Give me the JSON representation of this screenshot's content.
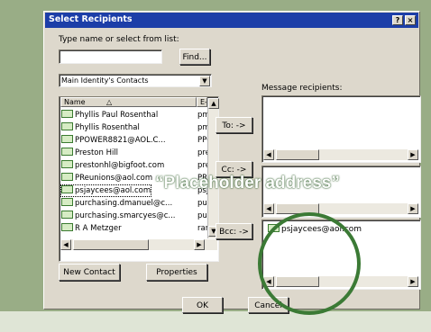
{
  "dialog": {
    "title": "Select Recipients",
    "help_glyph": "?",
    "close_glyph": "×"
  },
  "search": {
    "label": "Type name or select from list:",
    "value": "",
    "find_button": "Find..."
  },
  "address_book": {
    "selected": "Main Identity's Contacts",
    "dropdown_glyph": "▼"
  },
  "contact_list": {
    "columns": [
      "Name",
      "E-Mail"
    ],
    "rows": [
      {
        "name": "Phyllis Paul Rosenthal",
        "email": "pmr"
      },
      {
        "name": "Phyllis Rosenthal",
        "email": "pmr"
      },
      {
        "name": "PPOWER8821@AOL.C...",
        "email": "PPO"
      },
      {
        "name": "Preston Hill",
        "email": "prest"
      },
      {
        "name": "prestonhl@bigfoot.com",
        "email": "prest"
      },
      {
        "name": "PReunions@aol.com",
        "email": "PRe"
      },
      {
        "name": "psjaycees@aol.com",
        "email": "psja"
      },
      {
        "name": "purchasing.dmanuel@c...",
        "email": "purc"
      },
      {
        "name": "purchasing.smarcyes@c...",
        "email": "purc"
      },
      {
        "name": "R A Metzger",
        "email": "ramo"
      }
    ],
    "highlighted_index": 6
  },
  "recipients": {
    "label": "Message recipients:",
    "to_button": "To: ->",
    "cc_button": "Cc: ->",
    "bcc_button": "Bcc: ->",
    "bcc_entry": "psjaycees@aol.com"
  },
  "bottom_buttons": {
    "new_contact": "New Contact",
    "properties": "Properties",
    "ok": "OK",
    "cancel": "Cancel"
  },
  "annotation": {
    "text": "“Placeholder address”"
  },
  "colors": {
    "backdrop": "#99ad86",
    "title_bar": "#1c3ea8",
    "dialog_face": "#ddd8cc",
    "circle": "#3b7a35"
  }
}
